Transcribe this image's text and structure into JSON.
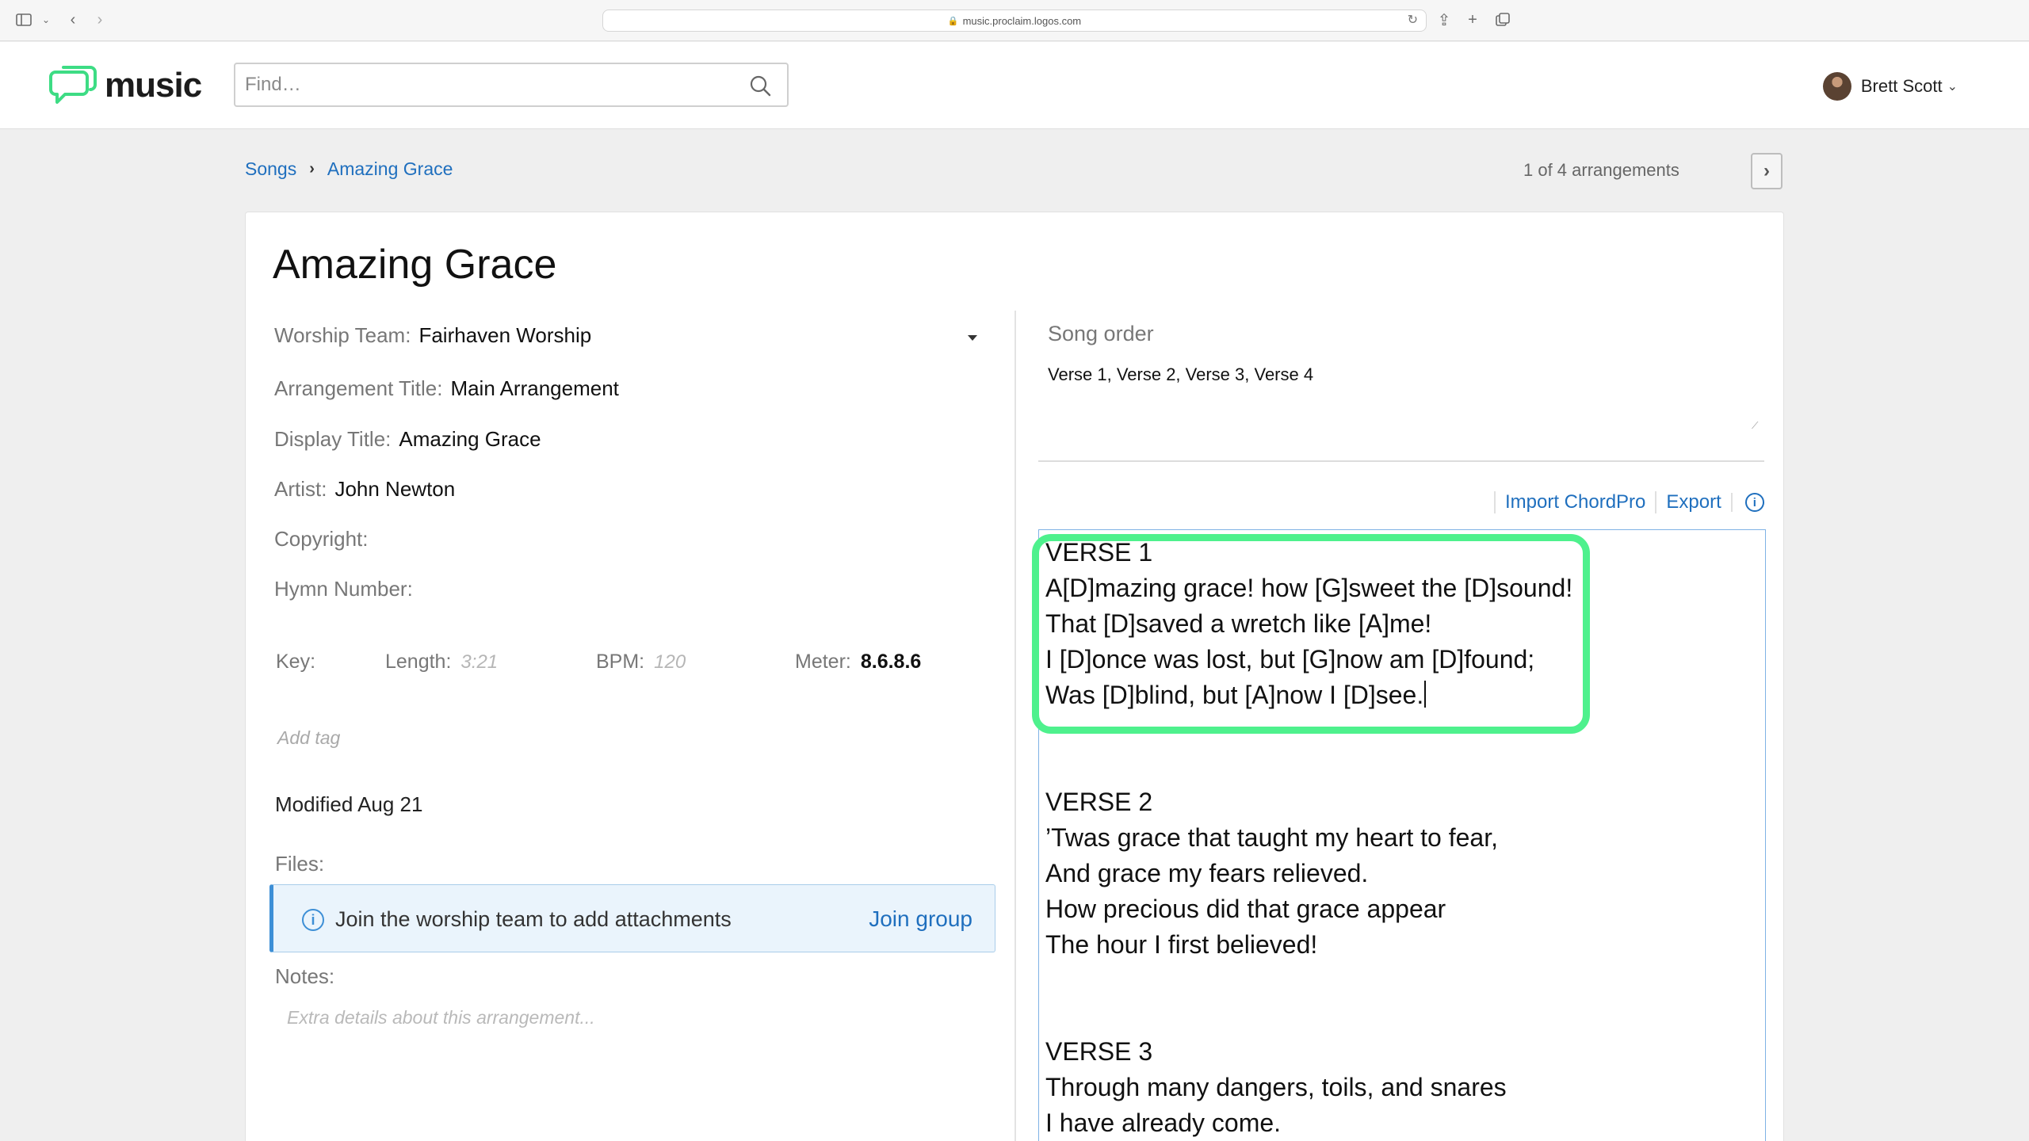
{
  "browser": {
    "url": "music.proclaim.logos.com"
  },
  "header": {
    "logo_text": "music",
    "search_placeholder": "Find…",
    "user_name": "Brett Scott"
  },
  "breadcrumb": {
    "items": [
      "Songs",
      "Amazing Grace"
    ],
    "arrangement_count": "1 of 4 arrangements"
  },
  "song": {
    "title": "Amazing Grace",
    "worship_team_label": "Worship Team:",
    "worship_team": "Fairhaven Worship",
    "arrangement_title_label": "Arrangement Title:",
    "arrangement_title": "Main Arrangement",
    "display_title_label": "Display Title:",
    "display_title": "Amazing Grace",
    "artist_label": "Artist:",
    "artist": "John Newton",
    "copyright_label": "Copyright:",
    "hymn_number_label": "Hymn Number:",
    "key_label": "Key:",
    "length_label": "Length:",
    "length_placeholder": "3:21",
    "bpm_label": "BPM:",
    "bpm_placeholder": "120",
    "meter_label": "Meter:",
    "meter": "8.6.8.6",
    "add_tag_placeholder": "Add tag",
    "modified": "Modified Aug 21",
    "files_label": "Files:",
    "files_notice": "Join the worship team to add attachments",
    "join_group": "Join group",
    "notes_label": "Notes:",
    "notes_placeholder": "Extra details about this arrangement..."
  },
  "right": {
    "song_order_label": "Song order",
    "song_order": "Verse 1,  Verse 2,  Verse 3,  Verse 4",
    "import_label": "Import ChordPro",
    "export_label": "Export"
  },
  "lyrics": {
    "verse1": [
      "VERSE 1",
      "A[D]mazing grace! how [G]sweet the [D]sound!",
      "That [D]saved a wretch like [A]me!",
      "I [D]once was lost, but [G]now am [D]found;",
      "Was [D]blind, but [A]now I [D]see."
    ],
    "verse2": [
      "VERSE 2",
      "’Twas grace that taught my heart to fear,",
      "And grace my fears relieved.",
      "How precious did that grace appear",
      "The hour I first believed!"
    ],
    "verse3": [
      "VERSE 3",
      "Through many dangers, toils, and snares",
      "I have already come."
    ]
  },
  "colors": {
    "accent_link": "#1f6fbe",
    "highlight": "#4ef18d",
    "logo_green": "#3ddc84"
  }
}
